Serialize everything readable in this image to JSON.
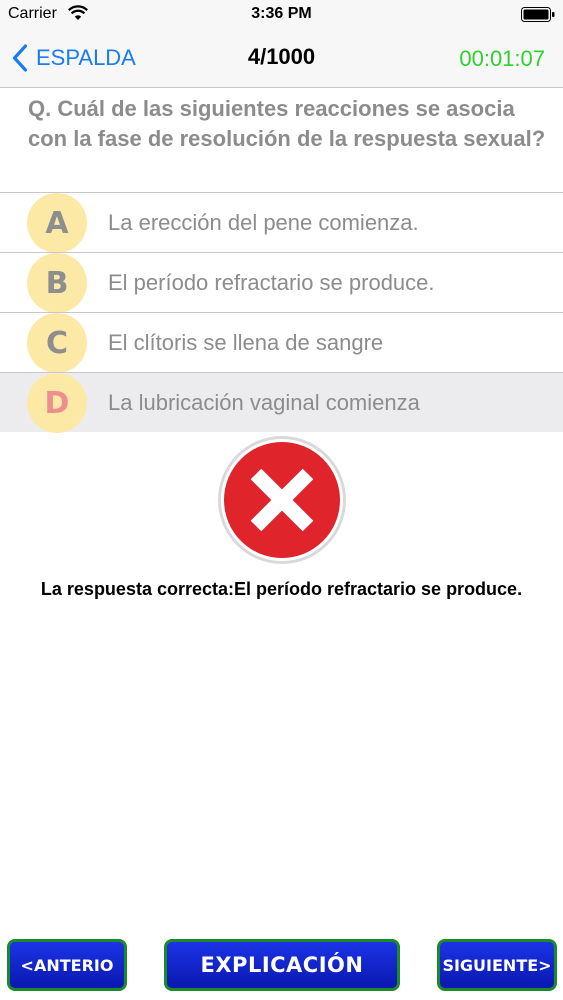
{
  "status_bar": {
    "carrier": "Carrier",
    "time": "3:36 PM",
    "wifi_icon": "wifi-icon",
    "battery_icon": "battery-icon"
  },
  "nav": {
    "back_label": "ESPALDA",
    "back_icon": "chevron-left-icon",
    "progress": "4/1000",
    "timer": "00:01:07",
    "accent_color": "#1a7cf2",
    "timer_color": "#2fd12f"
  },
  "question": {
    "text": "Q. Cuál de las siguientes reacciones se asocia con la fase de resolución de la respuesta sexual?"
  },
  "options": [
    {
      "letter": "A",
      "text": "La erección del pene comienza.",
      "selected": false
    },
    {
      "letter": "B",
      "text": "El período refractario se produce.",
      "selected": false
    },
    {
      "letter": "C",
      "text": "El clítoris se llena de sangre",
      "selected": false
    },
    {
      "letter": "D",
      "text": "La lubricación vaginal comienza",
      "selected": true
    }
  ],
  "result": {
    "icon": "wrong-answer-icon",
    "correct_answer_text": "La respuesta correcta:El período refractario se produce."
  },
  "footer": {
    "prev_label": "<ANTERIO",
    "explain_label": "EXPLICACIÓN",
    "next_label": "SIGUIENTE>"
  }
}
